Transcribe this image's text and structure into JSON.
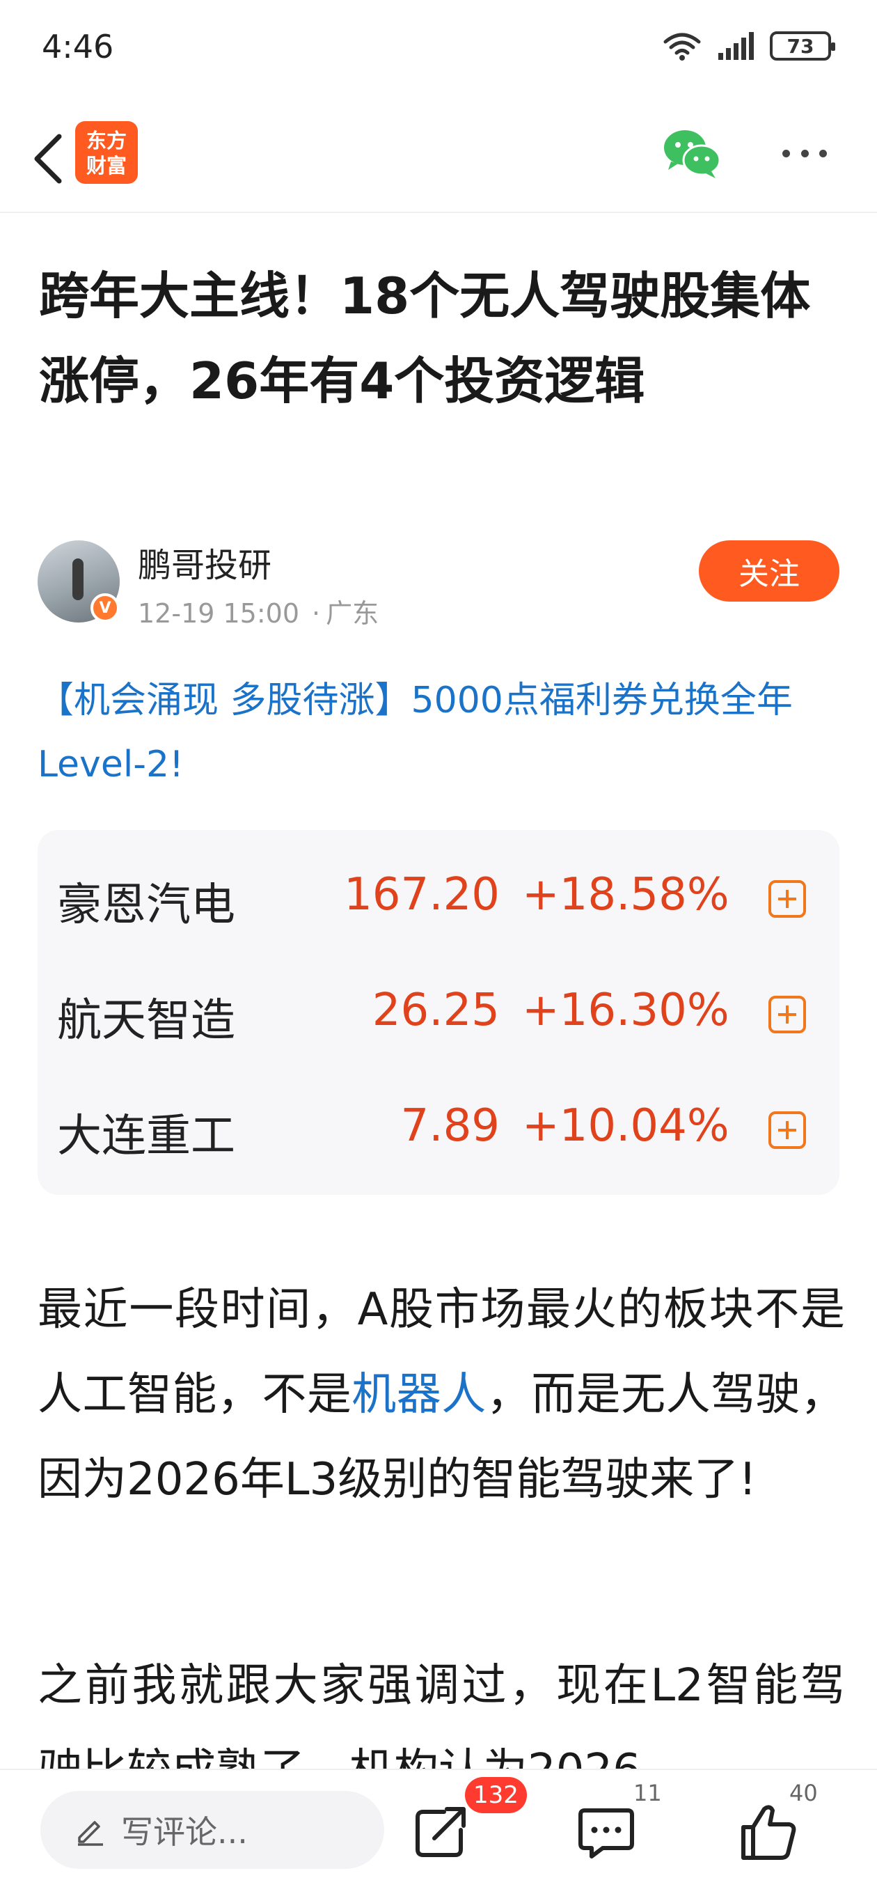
{
  "status_bar": {
    "time": "4:46",
    "battery": "73"
  },
  "navbar": {
    "logo_line1": "东方",
    "logo_line2": "财富",
    "brand_color": "#ff5a1f"
  },
  "article": {
    "title": "跨年大主线！18个无人驾驶股集体涨停，26年有4个投资逻辑",
    "author": "鹏哥投研",
    "verified_badge": "V",
    "date": "12-19 15:00",
    "location": "广东",
    "follow_label": "关注",
    "promo": "【机会涌现 多股待涨】5000点福利券兑换全年Level-2!",
    "paragraph1_a": "最近一段时间，A股市场最火的板块不是人工智能，不是",
    "paragraph1_link": "机器人",
    "paragraph1_b": "，而是无人驾驶，因为2026年L3级别的智能驾驶来了!",
    "paragraph2": "之前我就跟大家强调过，现在L2智能驾驶比较成熟了，机构认为2026"
  },
  "stocks": [
    {
      "name": "豪恩汽电",
      "price": "167.20",
      "change": "+18.58%"
    },
    {
      "name": "航天智造",
      "price": "26.25",
      "change": "+16.30%"
    },
    {
      "name": "大连重工",
      "price": "7.89",
      "change": "+10.04%"
    }
  ],
  "bottom_bar": {
    "comment_placeholder": "写评论...",
    "share_count": "132",
    "comment_count": "11",
    "like_count": "40",
    "icons": [
      "pencil-icon",
      "share-icon",
      "comment-icon",
      "thumbs-up-icon"
    ]
  },
  "colors": {
    "accent": "#ff5a1f",
    "link": "#1a73c8",
    "rise": "#e0421c"
  }
}
